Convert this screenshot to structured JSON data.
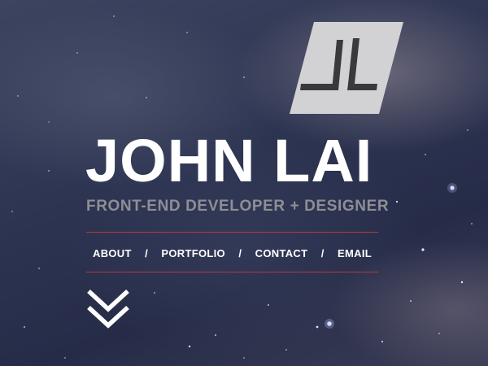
{
  "hero": {
    "name": "JOHN LAI",
    "subtitle": "FRONT-END DEVELOPER + DESIGNER"
  },
  "nav": {
    "items": [
      {
        "label": "ABOUT"
      },
      {
        "label": "PORTFOLIO"
      },
      {
        "label": "CONTACT"
      },
      {
        "label": "EMAIL"
      }
    ],
    "separator": "/"
  },
  "icons": {
    "logo": "jl-monogram-logo",
    "scroll": "double-chevron-down-icon"
  },
  "colors": {
    "accent_rule": "#b8393b",
    "logo_bg": "#d2d2d4",
    "logo_mark": "#3a3a3c",
    "subtitle": "#8e8e94",
    "text": "#ffffff"
  }
}
